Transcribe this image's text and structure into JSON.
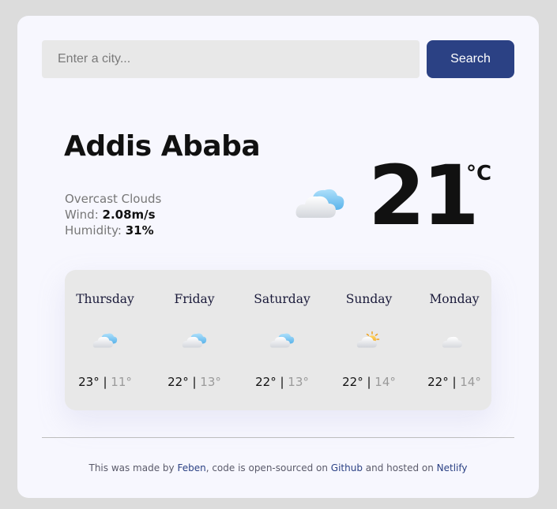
{
  "search": {
    "placeholder": "Enter a city...",
    "button_label": "Search"
  },
  "current": {
    "city": "Addis Ababa",
    "description": "Overcast Clouds",
    "wind_label": "Wind: ",
    "wind_value": "2.08m/s",
    "humidity_label": "Humidity: ",
    "humidity_value": "31%",
    "temperature": "21",
    "unit": "°C",
    "icon": "cloud-icon"
  },
  "forecast": [
    {
      "day": "Thursday",
      "max": "23°",
      "sep": " | ",
      "min": "11°",
      "icon": "cloud-icon"
    },
    {
      "day": "Friday",
      "max": "22°",
      "sep": " | ",
      "min": "13°",
      "icon": "cloud-icon"
    },
    {
      "day": "Saturday",
      "max": "22°",
      "sep": " | ",
      "min": "13°",
      "icon": "cloud-icon"
    },
    {
      "day": "Sunday",
      "max": "22°",
      "sep": " | ",
      "min": "14°",
      "icon": "partly-cloudy-icon"
    },
    {
      "day": "Monday",
      "max": "22°",
      "sep": " | ",
      "min": "14°",
      "icon": "light-cloud-icon"
    }
  ],
  "footer": {
    "text1": "This was made by ",
    "author": "Feben",
    "text2": ", code is open-sourced on ",
    "github": "Github",
    "text3": " and hosted on ",
    "netlify": "Netlify"
  },
  "colors": {
    "accent": "#2b4184",
    "card": "#f7f7fe",
    "background": "#dcdcdc",
    "forecast_panel": "#e8e8e8"
  }
}
